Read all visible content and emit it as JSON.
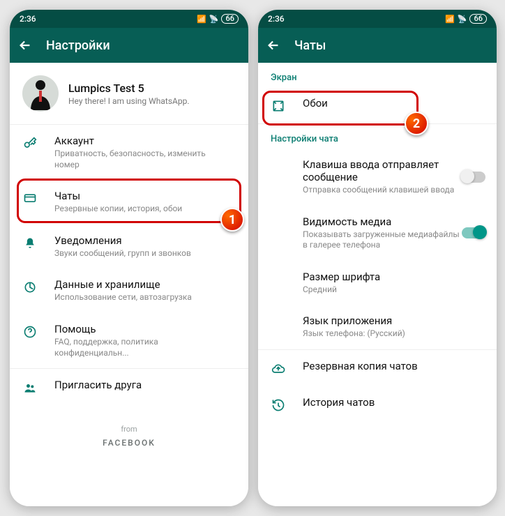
{
  "status": {
    "time": "2:36",
    "battery": "66"
  },
  "left": {
    "appbar_title": "Настройки",
    "profile": {
      "name": "Lumpics Test 5",
      "status": "Hey there! I am using WhatsApp."
    },
    "items": [
      {
        "title": "Аккаунт",
        "subtitle": "Приватность, безопасность, изменить номер"
      },
      {
        "title": "Чаты",
        "subtitle": "Резервные копии, история, обои"
      },
      {
        "title": "Уведомления",
        "subtitle": "Звуки сообщений, групп и звонков"
      },
      {
        "title": "Данные и хранилище",
        "subtitle": "Использование сети, автозагрузка"
      },
      {
        "title": "Помощь",
        "subtitle": "FAQ, поддержка, политика конфиденциальн..."
      },
      {
        "title": "Пригласить друга",
        "subtitle": ""
      }
    ],
    "footer_from": "from",
    "footer_brand": "FACEBOOK"
  },
  "right": {
    "appbar_title": "Чаты",
    "section_screen": "Экран",
    "wallpaper": {
      "title": "Обои"
    },
    "section_chat": "Настройки чата",
    "rows": [
      {
        "title": "Клавиша ввода отправляет сообщение",
        "subtitle": "Отправка сообщений клавишей ввода",
        "switch": "off"
      },
      {
        "title": "Видимость медиа",
        "subtitle": "Показывать загруженные медиафайлы в галерее телефона",
        "switch": "on"
      },
      {
        "title": "Размер шрифта",
        "subtitle": "Средний"
      },
      {
        "title": "Язык приложения",
        "subtitle": "Язык телефона: (Русский)"
      }
    ],
    "backup": {
      "title": "Резервная копия чатов"
    },
    "history": {
      "title": "История чатов"
    }
  },
  "badges": {
    "one": "1",
    "two": "2"
  }
}
